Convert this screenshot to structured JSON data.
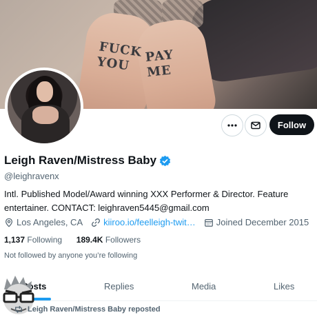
{
  "banner": {
    "tattoo_left": "FUCK YOU",
    "tattoo_right": "PAY ME"
  },
  "header": {
    "more_icon": "more-horizontal-icon",
    "message_icon": "envelope-icon",
    "follow_label": "Follow"
  },
  "profile": {
    "name": "Leigh Raven/Mistress Baby",
    "verified_icon": "verified-badge-icon",
    "handle": "@leighravenx",
    "bio": "Intl. Published Model/Award winning XXX Performer & Director. Feature entertainer. CONTACT: leighraven5445@gmail.com",
    "location": "Los Angeles, CA",
    "link": "kiiroo.io/feelleigh-twit…",
    "joined": "Joined December 2015",
    "following_count": "1,137",
    "following_label": "Following",
    "followers_count": "189.4K",
    "followers_label": "Followers",
    "not_followed": "Not followed by anyone you’re following"
  },
  "tabs": [
    {
      "label": "Posts"
    },
    {
      "label": "Replies"
    },
    {
      "label": "Media"
    },
    {
      "label": "Likes"
    }
  ],
  "timeline": {
    "repost_text": "Leigh Raven/Mistress Baby reposted"
  },
  "colors": {
    "accent": "#1d9bf0",
    "text": "#0f1419",
    "secondary": "#536471",
    "follow_bg": "#0f1419"
  }
}
